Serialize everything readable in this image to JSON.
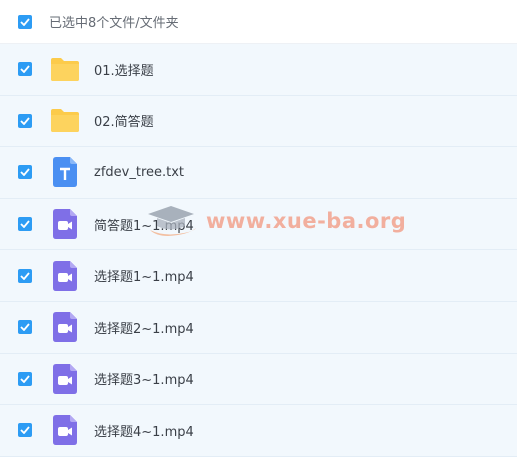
{
  "header": {
    "label": "已选中8个文件/文件夹",
    "checked": true
  },
  "items": [
    {
      "name": "01.选择题",
      "type": "folder-icon",
      "checked": true
    },
    {
      "name": "02.简答题",
      "type": "folder-icon",
      "checked": true
    },
    {
      "name": "zfdev_tree.txt",
      "type": "text-file-icon",
      "checked": true
    },
    {
      "name": "简答题1~1.mp4",
      "type": "video-file-icon",
      "checked": true
    },
    {
      "name": "选择题1~1.mp4",
      "type": "video-file-icon",
      "checked": true
    },
    {
      "name": "选择题2~1.mp4",
      "type": "video-file-icon",
      "checked": true
    },
    {
      "name": "选择题3~1.mp4",
      "type": "video-file-icon",
      "checked": true
    },
    {
      "name": "选择题4~1.mp4",
      "type": "video-file-icon",
      "checked": true
    }
  ],
  "watermark": {
    "text": "www.xue-ba.org"
  },
  "colors": {
    "checkbox": "#2d9cf4",
    "folder": "#fccb4b",
    "text_file": "#4a8ff2",
    "video_file": "#7f6fe7",
    "row_bg": "#f2f8fd",
    "watermark": "#f2a38e"
  }
}
